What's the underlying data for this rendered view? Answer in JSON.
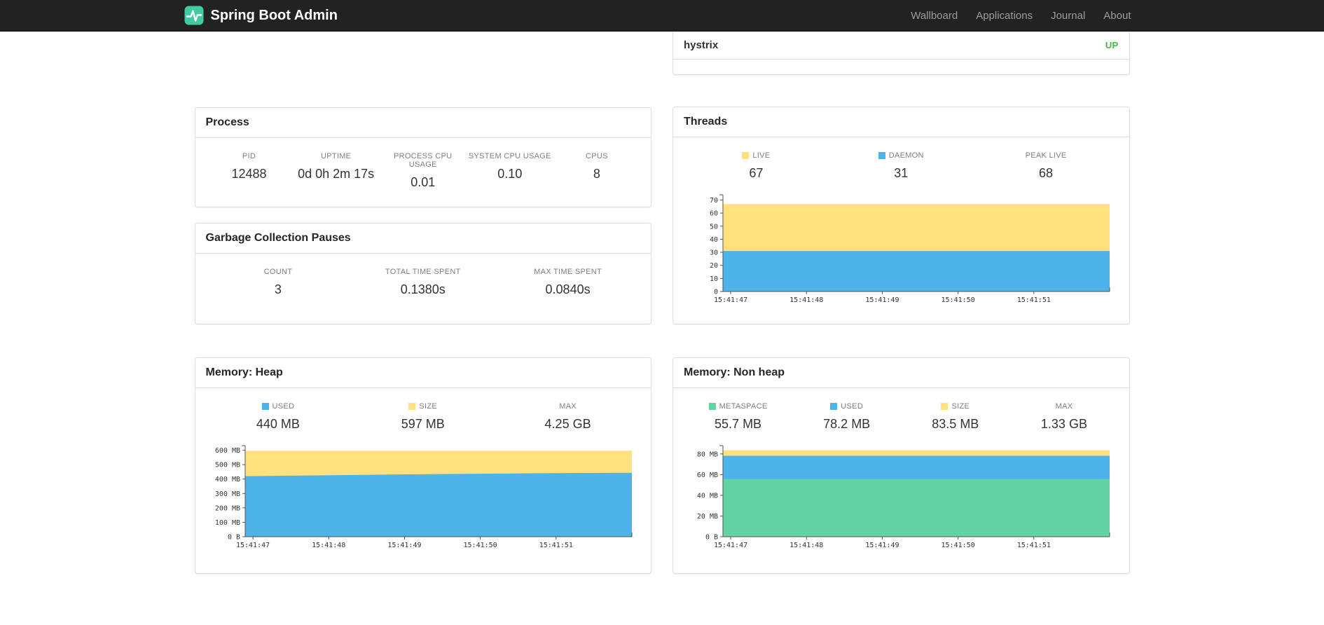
{
  "navbar": {
    "brand": "Spring Boot Admin",
    "links": [
      {
        "label": "Wallboard"
      },
      {
        "label": "Applications"
      },
      {
        "label": "Journal"
      },
      {
        "label": "About"
      }
    ]
  },
  "applications_panel": {
    "service": "hystrix",
    "status": "UP",
    "status_color": "#45b649"
  },
  "process": {
    "title": "Process",
    "stats": [
      {
        "label": "PID",
        "value": "12488"
      },
      {
        "label": "UPTIME",
        "value": "0d 0h 2m 17s"
      },
      {
        "label": "PROCESS CPU USAGE",
        "value": "0.01"
      },
      {
        "label": "SYSTEM CPU USAGE",
        "value": "0.10"
      },
      {
        "label": "CPUS",
        "value": "8"
      }
    ]
  },
  "gc": {
    "title": "Garbage Collection Pauses",
    "stats": [
      {
        "label": "COUNT",
        "value": "3"
      },
      {
        "label": "TOTAL TIME SPENT",
        "value": "0.1380s"
      },
      {
        "label": "MAX TIME SPENT",
        "value": "0.0840s"
      }
    ]
  },
  "threads": {
    "title": "Threads",
    "stats": [
      {
        "label": "LIVE",
        "value": "67",
        "color": "#ffe27d"
      },
      {
        "label": "DAEMON",
        "value": "31",
        "color": "#4db3e8"
      },
      {
        "label": "PEAK LIVE",
        "value": "68"
      }
    ]
  },
  "heap": {
    "title": "Memory: Heap",
    "stats": [
      {
        "label": "USED",
        "value": "440 MB",
        "color": "#4db3e8"
      },
      {
        "label": "SIZE",
        "value": "597 MB",
        "color": "#ffe27d"
      },
      {
        "label": "MAX",
        "value": "4.25 GB"
      }
    ]
  },
  "nonheap": {
    "title": "Memory: Non heap",
    "stats": [
      {
        "label": "METASPACE",
        "value": "55.7 MB",
        "color": "#63d3a6"
      },
      {
        "label": "USED",
        "value": "78.2 MB",
        "color": "#4db3e8"
      },
      {
        "label": "SIZE",
        "value": "83.5 MB",
        "color": "#ffe27d"
      },
      {
        "label": "MAX",
        "value": "1.33 GB"
      }
    ]
  },
  "chart_data": [
    {
      "id": "threads",
      "type": "area",
      "title": "Threads",
      "x_labels": [
        "15:41:47",
        "15:41:48",
        "15:41:49",
        "15:41:50",
        "15:41:51"
      ],
      "ylim": [
        0,
        74
      ],
      "y_ticks": [
        {
          "v": 0,
          "label": "0"
        },
        {
          "v": 10,
          "label": "10"
        },
        {
          "v": 20,
          "label": "20"
        },
        {
          "v": 30,
          "label": "30"
        },
        {
          "v": 40,
          "label": "40"
        },
        {
          "v": 50,
          "label": "50"
        },
        {
          "v": 60,
          "label": "60"
        },
        {
          "v": 70,
          "label": "70"
        }
      ],
      "series": [
        {
          "name": "LIVE",
          "color": "#ffe27d",
          "values": [
            67,
            67,
            67,
            67,
            67,
            67
          ]
        },
        {
          "name": "DAEMON",
          "color": "#4db3e8",
          "values": [
            31,
            31,
            31,
            31,
            31,
            31
          ]
        }
      ]
    },
    {
      "id": "memory-heap",
      "type": "area",
      "title": "Memory: Heap",
      "x_labels": [
        "15:41:47",
        "15:41:48",
        "15:41:49",
        "15:41:50",
        "15:41:51"
      ],
      "ylim": [
        0,
        632
      ],
      "y_ticks": [
        {
          "v": 0,
          "label": "0 B"
        },
        {
          "v": 100,
          "label": "100 MB"
        },
        {
          "v": 200,
          "label": "200 MB"
        },
        {
          "v": 300,
          "label": "300 MB"
        },
        {
          "v": 400,
          "label": "400 MB"
        },
        {
          "v": 500,
          "label": "500 MB"
        },
        {
          "v": 600,
          "label": "600 MB"
        }
      ],
      "series": [
        {
          "name": "SIZE",
          "color": "#ffe27d",
          "values": [
            597,
            597,
            597,
            597,
            597,
            597
          ]
        },
        {
          "name": "USED",
          "color": "#4db3e8",
          "values": [
            420,
            426,
            432,
            437,
            441,
            444
          ]
        }
      ]
    },
    {
      "id": "memory-nonheap",
      "type": "area",
      "title": "Memory: Non heap",
      "x_labels": [
        "15:41:47",
        "15:41:48",
        "15:41:49",
        "15:41:50",
        "15:41:51"
      ],
      "ylim": [
        0,
        88
      ],
      "y_ticks": [
        {
          "v": 0,
          "label": "0 B"
        },
        {
          "v": 20,
          "label": "20 MB"
        },
        {
          "v": 40,
          "label": "40 MB"
        },
        {
          "v": 60,
          "label": "60 MB"
        },
        {
          "v": 80,
          "label": "80 MB"
        }
      ],
      "series": [
        {
          "name": "SIZE",
          "color": "#ffe27d",
          "values": [
            83.5,
            83.5,
            83.5,
            83.5,
            83.5,
            83.5
          ]
        },
        {
          "name": "USED",
          "color": "#4db3e8",
          "values": [
            78.2,
            78.2,
            78.2,
            78.2,
            78.2,
            78.2
          ]
        },
        {
          "name": "METASPACE",
          "color": "#63d3a6",
          "values": [
            55.7,
            55.7,
            55.7,
            55.7,
            55.7,
            55.7
          ]
        }
      ]
    }
  ]
}
